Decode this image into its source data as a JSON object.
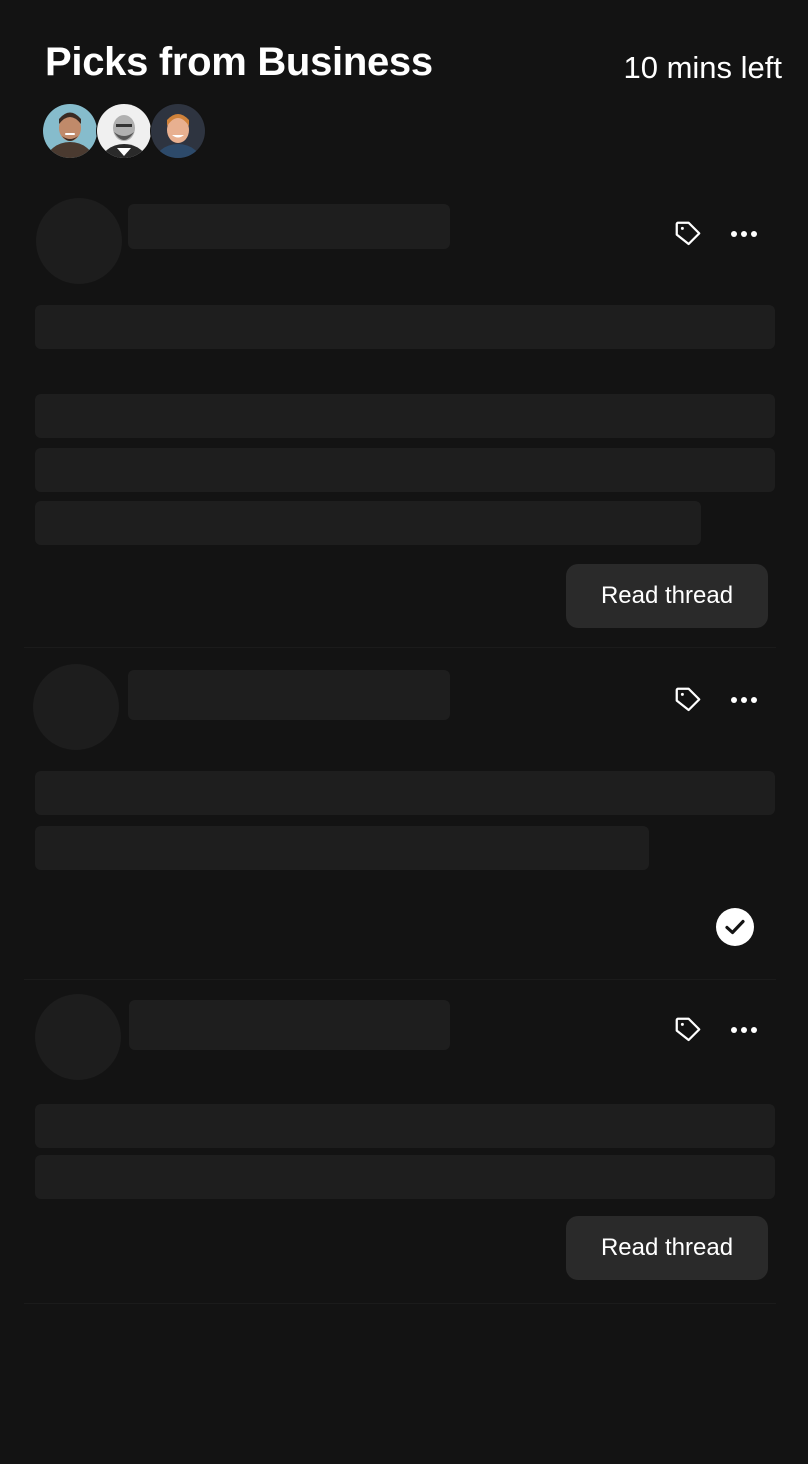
{
  "header": {
    "title": "Picks from Business",
    "time_left": "10 mins left"
  },
  "participants": [
    {
      "name": "avatar-1",
      "bg": "#7fb7c9"
    },
    {
      "name": "avatar-2",
      "bg": "#e9e9e9"
    },
    {
      "name": "avatar-3",
      "bg": "#2b3340"
    }
  ],
  "threads": [
    {
      "id": "thread-1",
      "action_label": "Read thread",
      "status": "unread",
      "tag_icon": "tag-icon",
      "more_icon": "more-icon"
    },
    {
      "id": "thread-2",
      "action_label": "",
      "status": "read",
      "tag_icon": "tag-icon",
      "more_icon": "more-icon",
      "status_icon": "check-circle-icon"
    },
    {
      "id": "thread-3",
      "action_label": "Read thread",
      "status": "unread",
      "tag_icon": "tag-icon",
      "more_icon": "more-icon"
    }
  ],
  "colors": {
    "background": "#131313",
    "skeleton": "#1e1e1e",
    "button": "#2a2a2a",
    "text": "#ffffff"
  }
}
